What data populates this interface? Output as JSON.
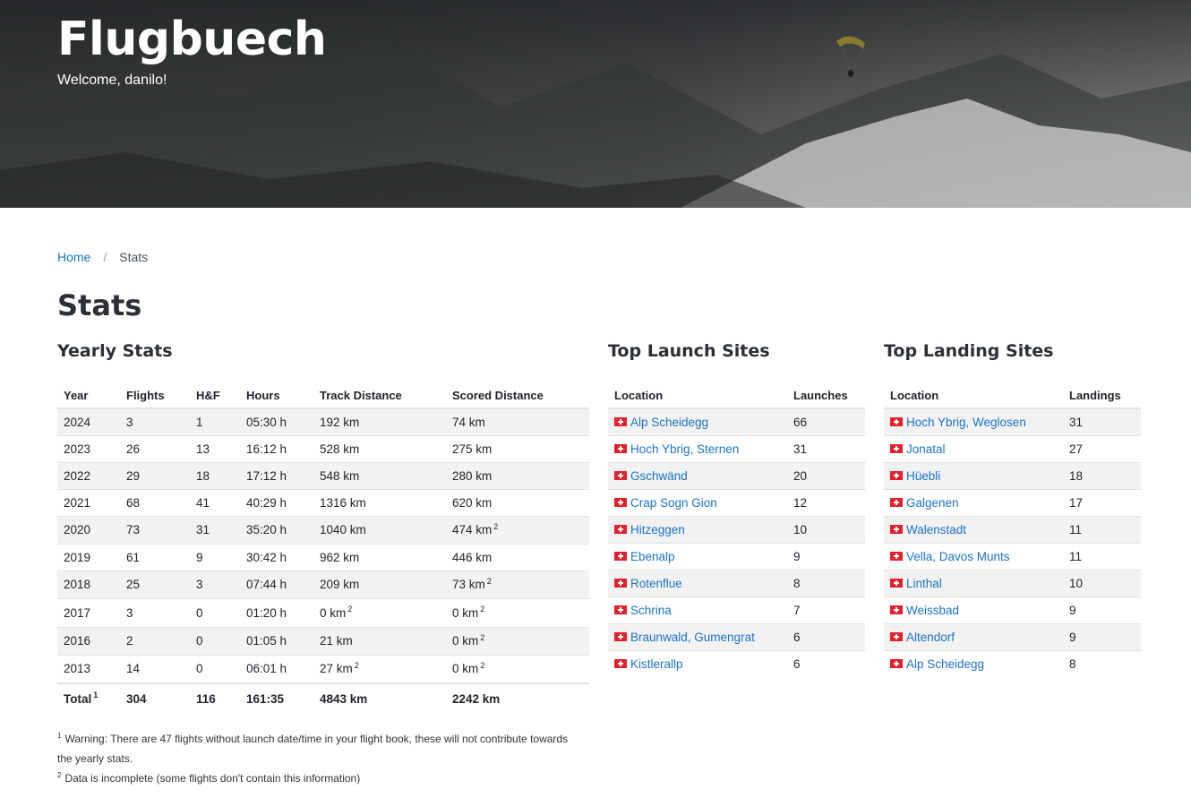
{
  "hero": {
    "title": "Flugbuech",
    "welcome": "Welcome, danilo!"
  },
  "breadcrumb": {
    "home": "Home",
    "separator": "/",
    "current": "Stats"
  },
  "page_title": "Stats",
  "yearly": {
    "title": "Yearly Stats",
    "headers": [
      "Year",
      "Flights",
      "H&F",
      "Hours",
      "Track Distance",
      "Scored Distance"
    ],
    "rows": [
      {
        "year": "2024",
        "flights": "3",
        "hf": "1",
        "hours": "05:30 h",
        "track": "192 km",
        "track_note": "",
        "scored": "74 km",
        "scored_note": ""
      },
      {
        "year": "2023",
        "flights": "26",
        "hf": "13",
        "hours": "16:12 h",
        "track": "528 km",
        "track_note": "",
        "scored": "275 km",
        "scored_note": ""
      },
      {
        "year": "2022",
        "flights": "29",
        "hf": "18",
        "hours": "17:12 h",
        "track": "548 km",
        "track_note": "",
        "scored": "280 km",
        "scored_note": ""
      },
      {
        "year": "2021",
        "flights": "68",
        "hf": "41",
        "hours": "40:29 h",
        "track": "1316 km",
        "track_note": "",
        "scored": "620 km",
        "scored_note": ""
      },
      {
        "year": "2020",
        "flights": "73",
        "hf": "31",
        "hours": "35:20 h",
        "track": "1040 km",
        "track_note": "",
        "scored": "474 km",
        "scored_note": "2"
      },
      {
        "year": "2019",
        "flights": "61",
        "hf": "9",
        "hours": "30:42 h",
        "track": "962 km",
        "track_note": "",
        "scored": "446 km",
        "scored_note": ""
      },
      {
        "year": "2018",
        "flights": "25",
        "hf": "3",
        "hours": "07:44 h",
        "track": "209 km",
        "track_note": "",
        "scored": "73 km",
        "scored_note": "2"
      },
      {
        "year": "2017",
        "flights": "3",
        "hf": "0",
        "hours": "01:20 h",
        "track": "0 km",
        "track_note": "2",
        "scored": "0 km",
        "scored_note": "2"
      },
      {
        "year": "2016",
        "flights": "2",
        "hf": "0",
        "hours": "01:05 h",
        "track": "21 km",
        "track_note": "",
        "scored": "0 km",
        "scored_note": "2"
      },
      {
        "year": "2013",
        "flights": "14",
        "hf": "0",
        "hours": "06:01 h",
        "track": "27 km",
        "track_note": "2",
        "scored": "0 km",
        "scored_note": "2"
      }
    ],
    "total": {
      "label": "Total",
      "label_note": "1",
      "flights": "304",
      "hf": "116",
      "hours": "161:35",
      "track": "4843 km",
      "scored": "2242 km"
    }
  },
  "launch": {
    "title": "Top Launch Sites",
    "headers": [
      "Location",
      "Launches"
    ],
    "rows": [
      {
        "name": "Alp Scheidegg",
        "count": "66"
      },
      {
        "name": "Hoch Ybrig, Sternen",
        "count": "31"
      },
      {
        "name": "Gschwänd",
        "count": "20"
      },
      {
        "name": "Crap Sogn Gion",
        "count": "12"
      },
      {
        "name": "Hitzeggen",
        "count": "10"
      },
      {
        "name": "Ebenalp",
        "count": "9"
      },
      {
        "name": "Rotenflue",
        "count": "8"
      },
      {
        "name": "Schrina",
        "count": "7"
      },
      {
        "name": "Braunwald, Gumengrat",
        "count": "6"
      },
      {
        "name": "Kistlerallp",
        "count": "6"
      }
    ]
  },
  "landing": {
    "title": "Top Landing Sites",
    "headers": [
      "Location",
      "Landings"
    ],
    "rows": [
      {
        "name": "Hoch Ybrig, Weglosen",
        "count": "31"
      },
      {
        "name": "Jonatal",
        "count": "27"
      },
      {
        "name": "Hüebli",
        "count": "18"
      },
      {
        "name": "Galgenen",
        "count": "17"
      },
      {
        "name": "Walenstadt",
        "count": "11"
      },
      {
        "name": "Vella, Davos Munts",
        "count": "11"
      },
      {
        "name": "Linthal",
        "count": "10"
      },
      {
        "name": "Weissbad",
        "count": "9"
      },
      {
        "name": "Altendorf",
        "count": "9"
      },
      {
        "name": "Alp Scheidegg",
        "count": "8"
      }
    ]
  },
  "footnotes": [
    {
      "mark": "1",
      "text": "Warning: There are 47 flights without launch date/time in your flight book, these will not contribute towards the yearly stats."
    },
    {
      "mark": "2",
      "text": "Data is incomplete (some flights don't contain this information)"
    }
  ],
  "colors": {
    "link": "#1a73c9",
    "flag_red": "#e4202b",
    "stripe": "#f2f2f2"
  },
  "icons": [
    "paraglider-icon",
    "swiss-flag-icon"
  ]
}
